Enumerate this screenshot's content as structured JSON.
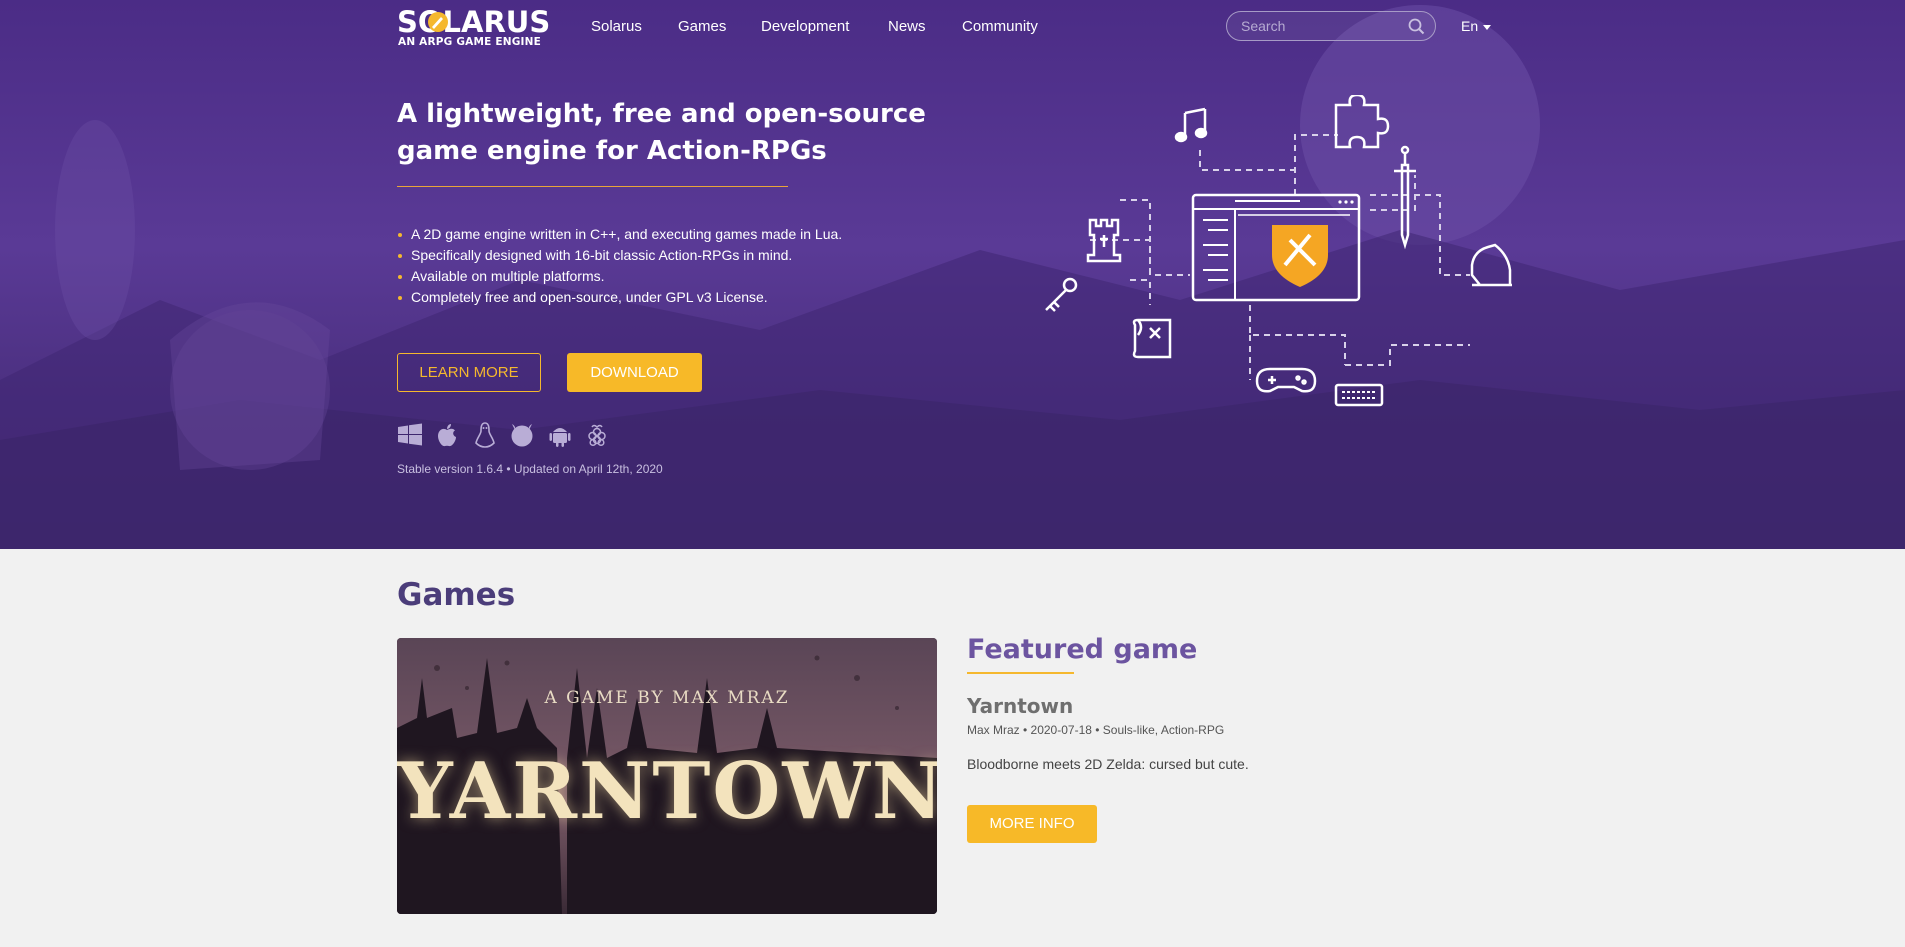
{
  "brand": {
    "name": "SOLARUS",
    "tagline": "AN ARPG GAME ENGINE"
  },
  "nav": {
    "items": [
      {
        "label": "Solarus"
      },
      {
        "label": "Games"
      },
      {
        "label": "Development"
      },
      {
        "label": "News"
      },
      {
        "label": "Community"
      }
    ],
    "search_placeholder": "Search",
    "language": "En"
  },
  "hero": {
    "title": "A lightweight, free and open-source game engine for Action-RPGs",
    "bullets": [
      "A 2D game engine written in C++, and executing games made in Lua.",
      "Specifically designed with 16-bit classic Action-RPGs in mind.",
      "Available on multiple platforms.",
      "Completely free and open-source, under GPL v3 License."
    ],
    "learn_more": "LEARN MORE",
    "download": "DOWNLOAD",
    "platforms": [
      "windows-icon",
      "apple-icon",
      "linux-icon",
      "freebsd-icon",
      "android-icon",
      "raspberry-pi-icon"
    ],
    "version_text": "Stable version 1.6.4 • Updated on April 12th, 2020"
  },
  "games": {
    "section_title": "Games",
    "image_byline": "A GAME BY MAX MRAZ",
    "image_title": "YARNTOWN",
    "featured_label": "Featured game",
    "name": "Yarntown",
    "meta": "Max Mraz • 2020-07-18 • Souls-like, Action-RPG",
    "description": "Bloodborne meets 2D Zelda: cursed but cute.",
    "more_info": "MORE INFO"
  },
  "colors": {
    "accent": "#f7b928",
    "hero_purple": "#4b2c86",
    "heading_purple": "#4b3d7a"
  }
}
